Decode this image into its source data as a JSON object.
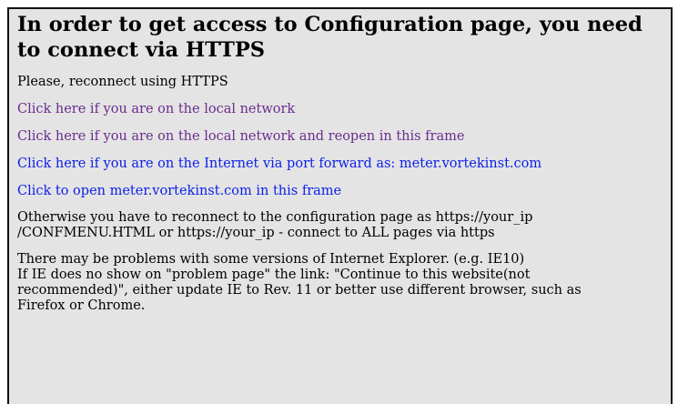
{
  "colors": {
    "background": "#e4e4e4",
    "visited_link": "#6a2c8e",
    "link": "#0a1ee8",
    "border": "#111111"
  },
  "heading": {
    "line1": "In order to get access to Configuration page, you need",
    "line2": "to connect via HTTPS"
  },
  "instruction": "Please, reconnect using HTTPS",
  "links": [
    {
      "label": "Click here if you are on the local network",
      "visited": true
    },
    {
      "label": "Click here if you are on the local network and reopen in this frame",
      "visited": true
    },
    {
      "label": "Click here if you are on the Internet via port forward as: meter.vortekinst.com",
      "visited": false
    },
    {
      "label": "Click to open meter.vortekinst.com in this frame",
      "visited": false
    }
  ],
  "otherwise": {
    "line1": "Otherwise you have to reconnect to the configuration page as https://your_ip",
    "line2": "/CONFMENU.HTML or https://your_ip - connect to ALL pages via https"
  },
  "ie_note": {
    "line1": "There may be problems with some versions of Internet Explorer. (e.g. IE10)",
    "line2": "If IE does no show on \"problem page\" the link: \"Continue to this website(not",
    "line3": "recommended)\", either update IE to Rev. 11 or better use different browser, such as",
    "line4": "Firefox or Chrome."
  }
}
